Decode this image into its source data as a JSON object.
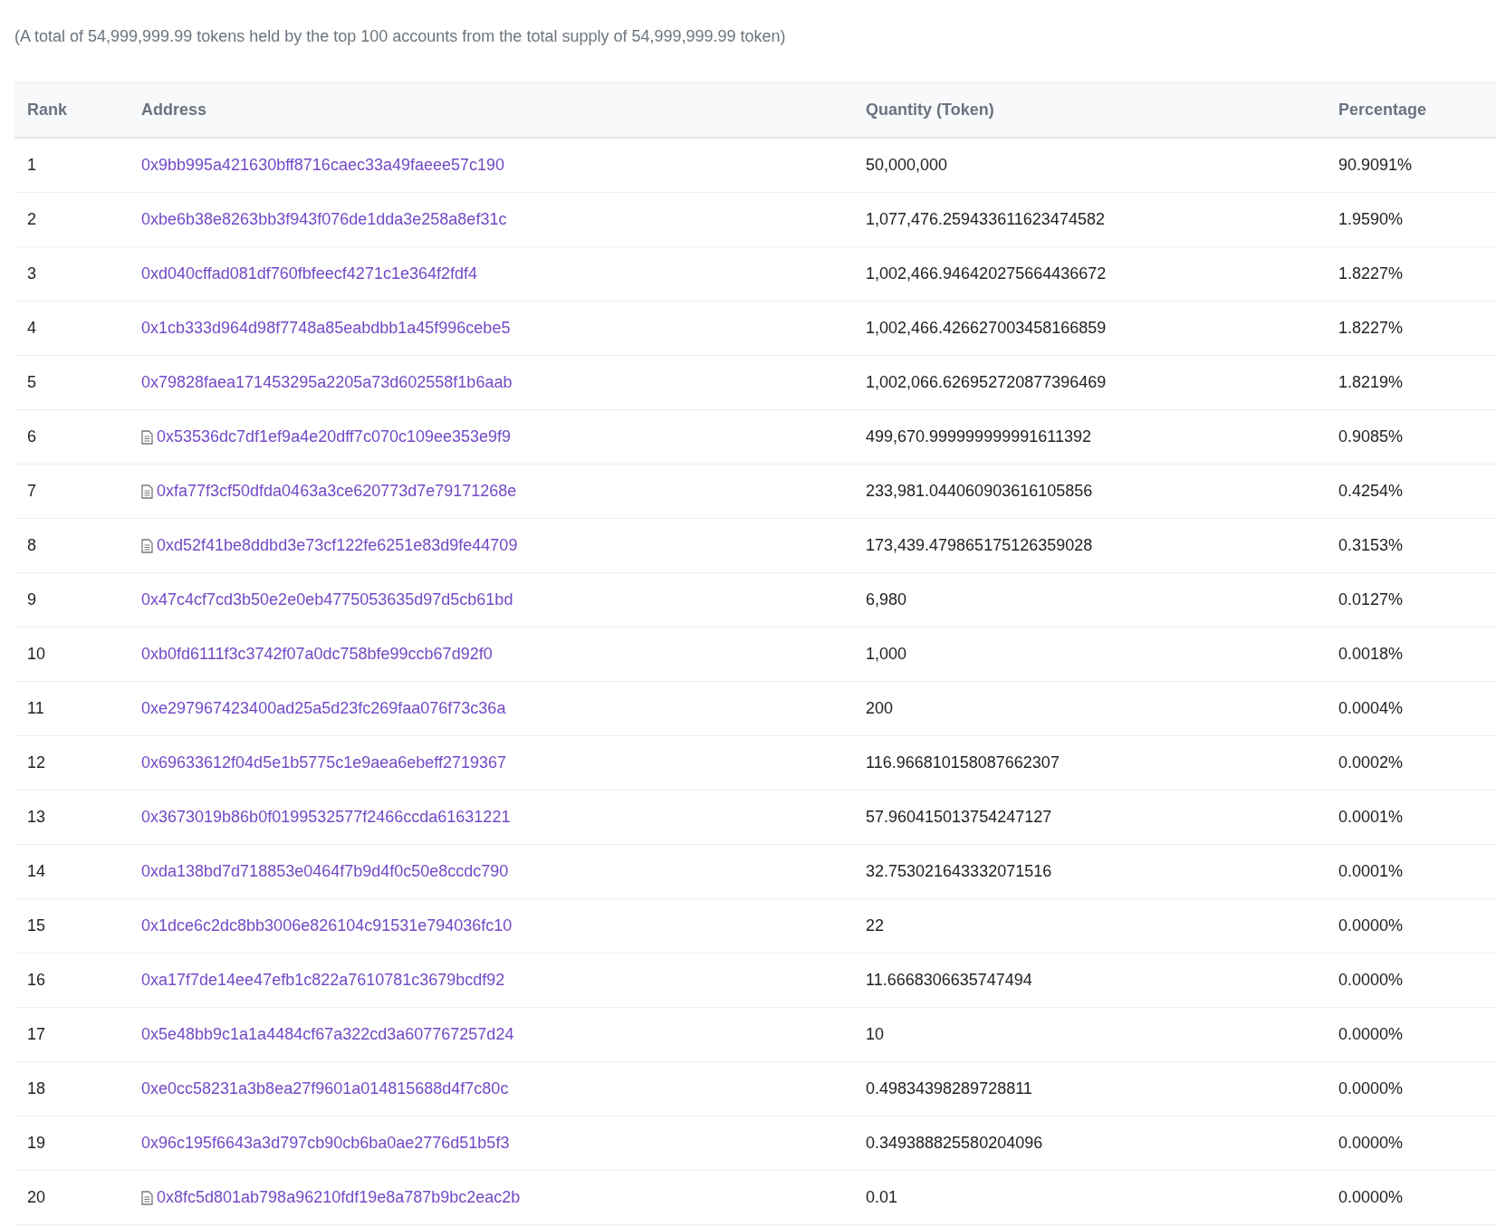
{
  "summary": "(A total of 54,999,999.99 tokens held by the top 100 accounts from the total supply of 54,999,999.99 token)",
  "table": {
    "columns": [
      "Rank",
      "Address",
      "Quantity (Token)",
      "Percentage"
    ],
    "rows": [
      {
        "rank": "1",
        "address": "0x9bb995a421630bff8716caec33a49faeee57c190",
        "is_contract": false,
        "quantity": "50,000,000",
        "percentage": "90.9091%"
      },
      {
        "rank": "2",
        "address": "0xbe6b38e8263bb3f943f076de1dda3e258a8ef31c",
        "is_contract": false,
        "quantity": "1,077,476.259433611623474582",
        "percentage": "1.9590%"
      },
      {
        "rank": "3",
        "address": "0xd040cffad081df760fbfeecf4271c1e364f2fdf4",
        "is_contract": false,
        "quantity": "1,002,466.946420275664436672",
        "percentage": "1.8227%"
      },
      {
        "rank": "4",
        "address": "0x1cb333d964d98f7748a85eabdbb1a45f996cebe5",
        "is_contract": false,
        "quantity": "1,002,466.426627003458166859",
        "percentage": "1.8227%"
      },
      {
        "rank": "5",
        "address": "0x79828faea171453295a2205a73d602558f1b6aab",
        "is_contract": false,
        "quantity": "1,002,066.626952720877396469",
        "percentage": "1.8219%"
      },
      {
        "rank": "6",
        "address": "0x53536dc7df1ef9a4e20dff7c070c109ee353e9f9",
        "is_contract": true,
        "quantity": "499,670.999999999991611392",
        "percentage": "0.9085%"
      },
      {
        "rank": "7",
        "address": "0xfa77f3cf50dfda0463a3ce620773d7e79171268e",
        "is_contract": true,
        "quantity": "233,981.044060903616105856",
        "percentage": "0.4254%"
      },
      {
        "rank": "8",
        "address": "0xd52f41be8ddbd3e73cf122fe6251e83d9fe44709",
        "is_contract": true,
        "quantity": "173,439.479865175126359028",
        "percentage": "0.3153%"
      },
      {
        "rank": "9",
        "address": "0x47c4cf7cd3b50e2e0eb4775053635d97d5cb61bd",
        "is_contract": false,
        "quantity": "6,980",
        "percentage": "0.0127%"
      },
      {
        "rank": "10",
        "address": "0xb0fd6111f3c3742f07a0dc758bfe99ccb67d92f0",
        "is_contract": false,
        "quantity": "1,000",
        "percentage": "0.0018%"
      },
      {
        "rank": "11",
        "address": "0xe297967423400ad25a5d23fc269faa076f73c36a",
        "is_contract": false,
        "quantity": "200",
        "percentage": "0.0004%"
      },
      {
        "rank": "12",
        "address": "0x69633612f04d5e1b5775c1e9aea6ebeff2719367",
        "is_contract": false,
        "quantity": "116.966810158087662307",
        "percentage": "0.0002%"
      },
      {
        "rank": "13",
        "address": "0x3673019b86b0f0199532577f2466ccda61631221",
        "is_contract": false,
        "quantity": "57.960415013754247127",
        "percentage": "0.0001%"
      },
      {
        "rank": "14",
        "address": "0xda138bd7d718853e0464f7b9d4f0c50e8ccdc790",
        "is_contract": false,
        "quantity": "32.753021643332071516",
        "percentage": "0.0001%"
      },
      {
        "rank": "15",
        "address": "0x1dce6c2dc8bb3006e826104c91531e794036fc10",
        "is_contract": false,
        "quantity": "22",
        "percentage": "0.0000%"
      },
      {
        "rank": "16",
        "address": "0xa17f7de14ee47efb1c822a7610781c3679bcdf92",
        "is_contract": false,
        "quantity": "11.6668306635747494",
        "percentage": "0.0000%"
      },
      {
        "rank": "17",
        "address": "0x5e48bb9c1a1a4484cf67a322cd3a607767257d24",
        "is_contract": false,
        "quantity": "10",
        "percentage": "0.0000%"
      },
      {
        "rank": "18",
        "address": "0xe0cc58231a3b8ea27f9601a014815688d4f7c80c",
        "is_contract": false,
        "quantity": "0.49834398289728811",
        "percentage": "0.0000%"
      },
      {
        "rank": "19",
        "address": "0x96c195f6643a3d797cb90cb6ba0ae2776d51b5f3",
        "is_contract": false,
        "quantity": "0.349388825580204096",
        "percentage": "0.0000%"
      },
      {
        "rank": "20",
        "address": "0x8fc5d801ab798a96210fdf19e8a787b9bc2eac2b",
        "is_contract": true,
        "quantity": "0.01",
        "percentage": "0.0000%"
      }
    ]
  }
}
